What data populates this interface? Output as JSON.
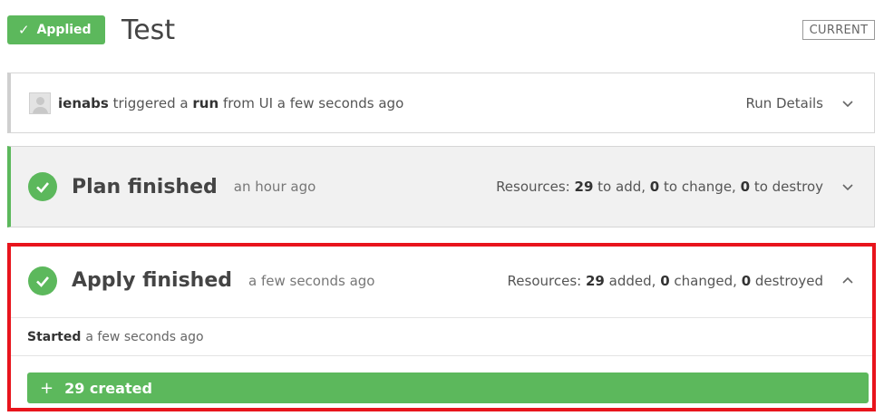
{
  "header": {
    "status_badge": "Applied",
    "title": "Test",
    "current_badge": "CURRENT"
  },
  "trigger": {
    "user": "ienabs",
    "text1": "triggered a",
    "run_word": "run",
    "text2": "from UI a few seconds ago",
    "details_label": "Run Details"
  },
  "plan": {
    "title": "Plan finished",
    "time": "an hour ago",
    "resources_label": "Resources:",
    "to_add_count": "29",
    "to_add_label": "to add,",
    "to_change_count": "0",
    "to_change_label": "to change,",
    "to_destroy_count": "0",
    "to_destroy_label": "to destroy"
  },
  "apply": {
    "title": "Apply finished",
    "time": "a few seconds ago",
    "resources_label": "Resources:",
    "added_count": "29",
    "added_label": "added,",
    "changed_count": "0",
    "changed_label": "changed,",
    "destroyed_count": "0",
    "destroyed_label": "destroyed",
    "started_label": "Started",
    "started_time": "a few seconds ago",
    "created_label": "29 created"
  },
  "colors": {
    "success": "#5cb85c",
    "highlight": "#e8141c"
  },
  "icons": {
    "status": "check-icon",
    "collapse": "chevron-down-icon",
    "expand": "chevron-up-icon",
    "created": "plus-icon"
  }
}
